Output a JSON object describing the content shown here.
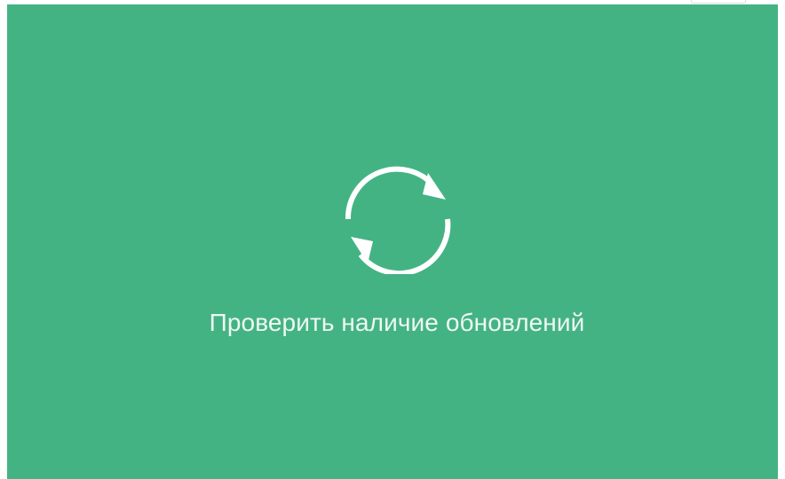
{
  "panel": {
    "action_label": "Проверить наличие обновлений",
    "icon": "refresh-icon",
    "background_color": "#44b384",
    "foreground_color": "#ffffff"
  }
}
